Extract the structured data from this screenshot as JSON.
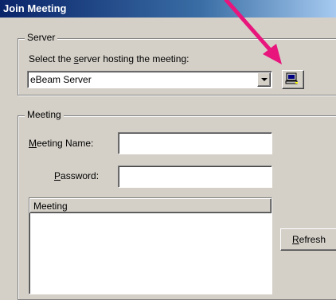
{
  "window": {
    "title": "Join Meeting"
  },
  "server": {
    "group_label": "Server",
    "select_prefix": "Select the ",
    "select_hotkey": "s",
    "select_suffix": "erver hosting the meeting:",
    "selected_value": "eBeam Server",
    "browse_icon": "computer-icon"
  },
  "meeting": {
    "group_label": "Meeting",
    "name_hotkey": "M",
    "name_suffix": "eeting Name:",
    "name_value": "",
    "password_hotkey": "P",
    "password_suffix": "assword:",
    "password_value": "",
    "list_header": "Meeting",
    "refresh_hotkey": "R",
    "refresh_suffix": "efresh"
  },
  "colors": {
    "title_bar": "#0a246a",
    "dialog_bg": "#d4d0c8",
    "annotation_arrow": "#e8157c"
  }
}
